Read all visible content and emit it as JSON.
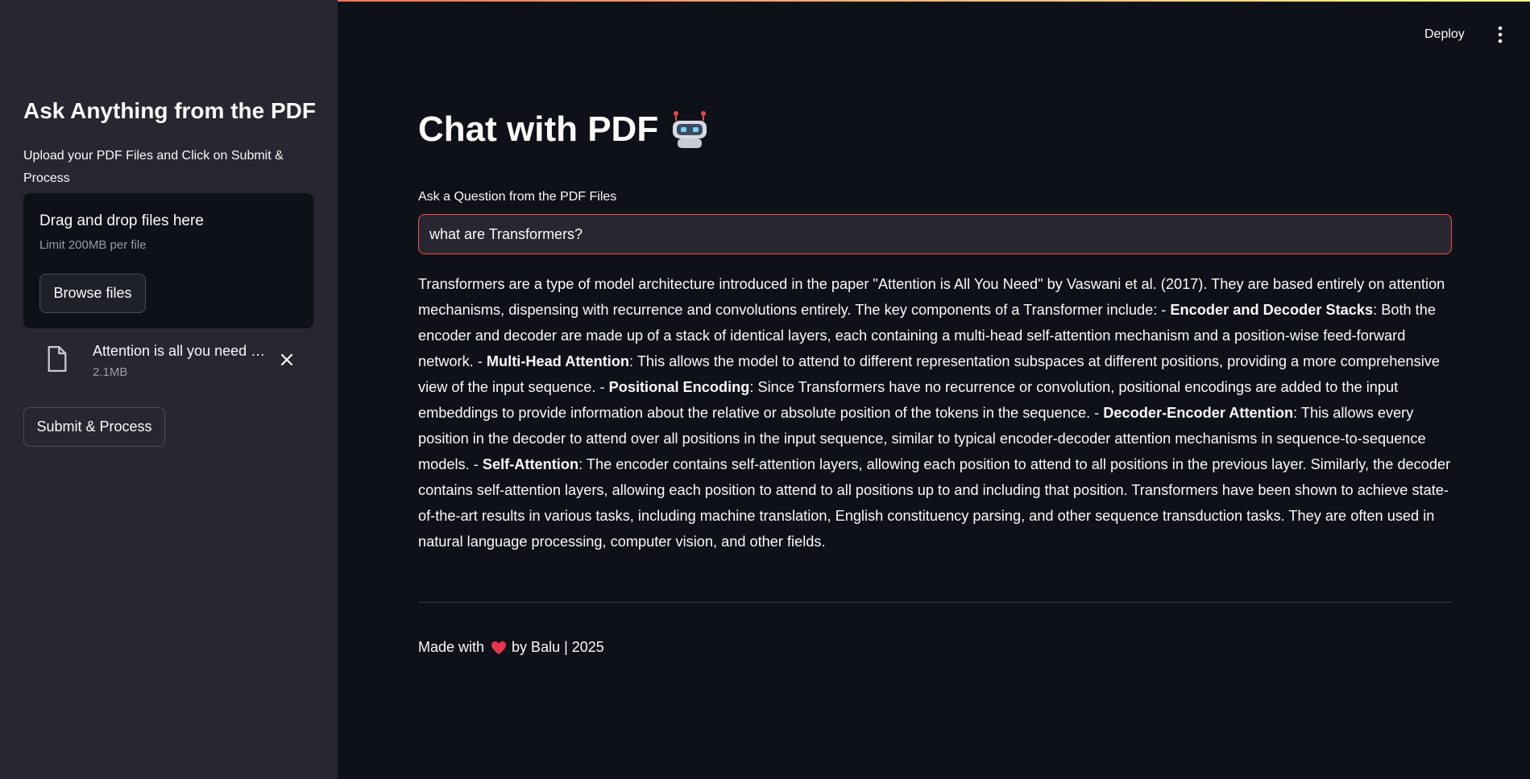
{
  "sidebar": {
    "title": "Ask Anything from the PDF",
    "subtitle": "Upload your PDF Files and Click on Submit & Process",
    "dropzone": {
      "title": "Drag and drop files here",
      "limit": "Limit 200MB per file",
      "browse_label": "Browse files"
    },
    "file": {
      "name": "Attention is all you need …",
      "size": "2.1MB",
      "icon": "file-icon"
    },
    "submit_label": "Submit & Process"
  },
  "header": {
    "deploy_label": "Deploy",
    "menu_icon": "vertical-dots-icon"
  },
  "main": {
    "title": "Chat with PDF",
    "title_icon": "robot-icon",
    "question_label": "Ask a Question from the PDF Files",
    "question_value": "what are Transformers?",
    "answer": [
      {
        "text": "Transformers are a type of model architecture introduced in the paper \"Attention is All You Need\" by Vaswani et al. (2017). They are based entirely on attention mechanisms, dispensing with recurrence and convolutions entirely. The key components of a Transformer include: - "
      },
      {
        "text": "Encoder and Decoder Stacks",
        "bold": true
      },
      {
        "text": ": Both the encoder and decoder are made up of a stack of identical layers, each containing a multi-head self-attention mechanism and a position-wise feed-forward network. - "
      },
      {
        "text": "Multi-Head Attention",
        "bold": true
      },
      {
        "text": ": This allows the model to attend to different representation subspaces at different positions, providing a more comprehensive view of the input sequence. - "
      },
      {
        "text": "Positional Encoding",
        "bold": true
      },
      {
        "text": ": Since Transformers have no recurrence or convolution, positional encodings are added to the input embeddings to provide information about the relative or absolute position of the tokens in the sequence. - "
      },
      {
        "text": "Decoder-Encoder Attention",
        "bold": true
      },
      {
        "text": ": This allows every position in the decoder to attend over all positions in the input sequence, similar to typical encoder-decoder attention mechanisms in sequence-to-sequence models. - "
      },
      {
        "text": "Self-Attention",
        "bold": true
      },
      {
        "text": ": The encoder contains self-attention layers, allowing each position to attend to all positions in the previous layer. Similarly, the decoder contains self-attention layers, allowing each position to attend to all positions up to and including that position. Transformers have been shown to achieve state-of-the-art results in various tasks, including machine translation, English constituency parsing, and other sequence transduction tasks. They are often used in natural language processing, computer vision, and other fields."
      }
    ],
    "footer": {
      "made_with": "Made with",
      "heart_icon": "heart-icon",
      "by": "by Balu | 2025"
    }
  },
  "colors": {
    "background": "#0e1117",
    "sidebar": "#262730",
    "accent": "#ff4b4b",
    "text": "#fafafa"
  }
}
